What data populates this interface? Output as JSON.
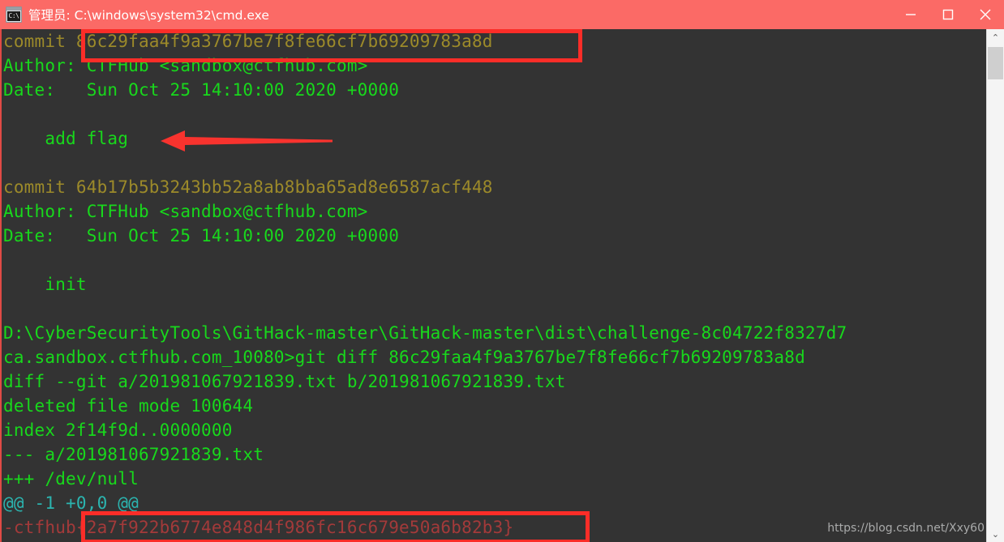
{
  "window": {
    "title": "管理员: C:\\windows\\system32\\cmd.exe",
    "icon_text": "C:\\",
    "icon_name": "cmd-window-icon",
    "titlebar_color": "#fb6a66",
    "console_bg": "#333333",
    "controls": {
      "minimize_label": "—",
      "maximize_label": "□",
      "close_label": "✕"
    }
  },
  "terminal": {
    "lines": [
      {
        "segments": [
          {
            "text": "commit ",
            "color": "yellow"
          },
          {
            "text": "86c29faa4f9a3767be7f8fe66cf7b69209783a8d",
            "color": "yellow"
          }
        ]
      },
      {
        "segments": [
          {
            "text": "Author: CTFHub <sandbox@ctfhub.com>",
            "color": "green"
          }
        ]
      },
      {
        "segments": [
          {
            "text": "Date:   Sun Oct 25 14:10:00 2020 +0000",
            "color": "green"
          }
        ]
      },
      {
        "segments": [
          {
            "text": "",
            "color": "green"
          }
        ]
      },
      {
        "segments": [
          {
            "text": "    add flag",
            "color": "green"
          }
        ]
      },
      {
        "segments": [
          {
            "text": "",
            "color": "green"
          }
        ]
      },
      {
        "segments": [
          {
            "text": "commit 64b17b5b3243bb52a8ab8bba65ad8e6587acf448",
            "color": "yellow"
          }
        ]
      },
      {
        "segments": [
          {
            "text": "Author: CTFHub <sandbox@ctfhub.com>",
            "color": "green"
          }
        ]
      },
      {
        "segments": [
          {
            "text": "Date:   Sun Oct 25 14:10:00 2020 +0000",
            "color": "green"
          }
        ]
      },
      {
        "segments": [
          {
            "text": "",
            "color": "green"
          }
        ]
      },
      {
        "segments": [
          {
            "text": "    init",
            "color": "green"
          }
        ]
      },
      {
        "segments": [
          {
            "text": "",
            "color": "green"
          }
        ]
      },
      {
        "segments": [
          {
            "text": "D:\\CyberSecurityTools\\GitHack-master\\GitHack-master\\dist\\challenge-8c04722f8327d7",
            "color": "green"
          }
        ]
      },
      {
        "segments": [
          {
            "text": "ca.sandbox.ctfhub.com_10080>git diff 86c29faa4f9a3767be7f8fe66cf7b69209783a8d",
            "color": "green"
          }
        ]
      },
      {
        "segments": [
          {
            "text": "diff --git a/201981067921839.txt b/201981067921839.txt",
            "color": "green"
          }
        ]
      },
      {
        "segments": [
          {
            "text": "deleted file mode 100644",
            "color": "green"
          }
        ]
      },
      {
        "segments": [
          {
            "text": "index 2f14f9d..0000000",
            "color": "green"
          }
        ]
      },
      {
        "segments": [
          {
            "text": "--- a/201981067921839.txt",
            "color": "green"
          }
        ]
      },
      {
        "segments": [
          {
            "text": "+++ /dev/null",
            "color": "green"
          }
        ]
      },
      {
        "segments": [
          {
            "text": "@@ -1 +0,0 @@",
            "color": "cyan"
          }
        ]
      },
      {
        "segments": [
          {
            "text": "-ctfhub{2a7f922b6774e848d4f986fc16c679e50a6b82b3}",
            "color": "red"
          }
        ]
      }
    ],
    "commit_hash_highlighted": "86c29faa4f9a3767be7f8fe66cf7b69209783a8d",
    "second_commit_hash": "64b17b5b3243bb52a8ab8bba65ad8e6587acf448",
    "flag_highlighted": "ctfhub{2a7f922b6774e848d4f986fc16c679e50a6b82b3}",
    "commit_message_pointed_at": "add flag",
    "git_command": "git diff 86c29faa4f9a3767be7f8fe66cf7b69209783a8d",
    "author": "CTFHub <sandbox@ctfhub.com>",
    "date": "Sun Oct 25 14:10:00 2020 +0000"
  },
  "annotations": {
    "highlight_color": "#fb2d28",
    "box_commit_hash_name": "commit-hash-highlight",
    "box_flag_name": "flag-highlight",
    "arrow_name": "add-flag-arrow"
  },
  "watermark": {
    "text": "https://blog.csdn.net/Xxy60"
  },
  "scrollbar": {
    "up_arrow": "⌃",
    "down_arrow": "⌄"
  }
}
